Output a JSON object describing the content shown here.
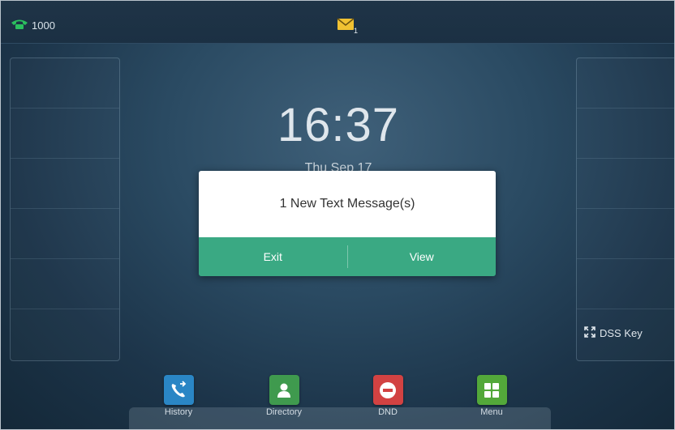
{
  "status_bar": {
    "account": "1000",
    "account_icon": "phone-handset-icon",
    "message_icon": "envelope-icon",
    "message_count": "1",
    "accent_color": "#2bbf5e"
  },
  "home": {
    "time": "16:37",
    "date": "Thu Sep 17"
  },
  "dss_key": {
    "label": "DSS Key",
    "icon": "expand-arrows-icon"
  },
  "dialog": {
    "message": "1 New Text Message(s)",
    "exit_label": "Exit",
    "view_label": "View",
    "button_color": "#3aa983"
  },
  "dock": [
    {
      "label": "History",
      "icon": "call-history-icon",
      "color": "#2a86c5"
    },
    {
      "label": "Directory",
      "icon": "contact-person-icon",
      "color": "#3f9a4e"
    },
    {
      "label": "DND",
      "icon": "no-entry-icon",
      "color": "#d24242"
    },
    {
      "label": "Menu",
      "icon": "grid-menu-icon",
      "color": "#53a83a"
    }
  ]
}
